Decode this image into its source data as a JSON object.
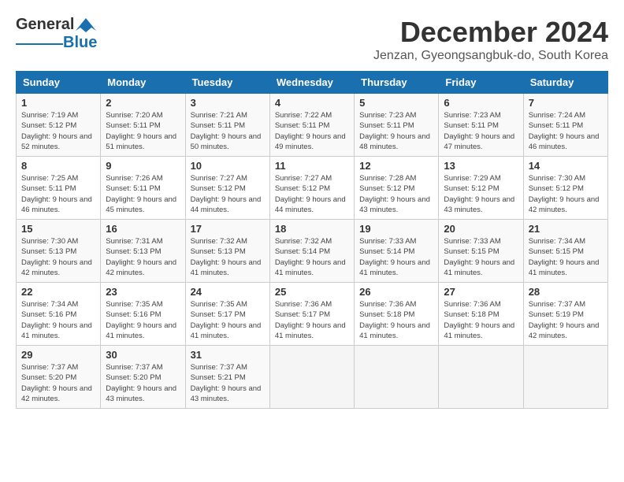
{
  "header": {
    "logo_general": "General",
    "logo_blue": "Blue",
    "month_title": "December 2024",
    "location": "Jenzan, Gyeongsangbuk-do, South Korea"
  },
  "days_of_week": [
    "Sunday",
    "Monday",
    "Tuesday",
    "Wednesday",
    "Thursday",
    "Friday",
    "Saturday"
  ],
  "weeks": [
    [
      {
        "day": 1,
        "sunrise": "7:19 AM",
        "sunset": "5:12 PM",
        "daylight": "9 hours and 52 minutes."
      },
      {
        "day": 2,
        "sunrise": "7:20 AM",
        "sunset": "5:11 PM",
        "daylight": "9 hours and 51 minutes."
      },
      {
        "day": 3,
        "sunrise": "7:21 AM",
        "sunset": "5:11 PM",
        "daylight": "9 hours and 50 minutes."
      },
      {
        "day": 4,
        "sunrise": "7:22 AM",
        "sunset": "5:11 PM",
        "daylight": "9 hours and 49 minutes."
      },
      {
        "day": 5,
        "sunrise": "7:23 AM",
        "sunset": "5:11 PM",
        "daylight": "9 hours and 48 minutes."
      },
      {
        "day": 6,
        "sunrise": "7:23 AM",
        "sunset": "5:11 PM",
        "daylight": "9 hours and 47 minutes."
      },
      {
        "day": 7,
        "sunrise": "7:24 AM",
        "sunset": "5:11 PM",
        "daylight": "9 hours and 46 minutes."
      }
    ],
    [
      {
        "day": 8,
        "sunrise": "7:25 AM",
        "sunset": "5:11 PM",
        "daylight": "9 hours and 46 minutes."
      },
      {
        "day": 9,
        "sunrise": "7:26 AM",
        "sunset": "5:11 PM",
        "daylight": "9 hours and 45 minutes."
      },
      {
        "day": 10,
        "sunrise": "7:27 AM",
        "sunset": "5:12 PM",
        "daylight": "9 hours and 44 minutes."
      },
      {
        "day": 11,
        "sunrise": "7:27 AM",
        "sunset": "5:12 PM",
        "daylight": "9 hours and 44 minutes."
      },
      {
        "day": 12,
        "sunrise": "7:28 AM",
        "sunset": "5:12 PM",
        "daylight": "9 hours and 43 minutes."
      },
      {
        "day": 13,
        "sunrise": "7:29 AM",
        "sunset": "5:12 PM",
        "daylight": "9 hours and 43 minutes."
      },
      {
        "day": 14,
        "sunrise": "7:30 AM",
        "sunset": "5:12 PM",
        "daylight": "9 hours and 42 minutes."
      }
    ],
    [
      {
        "day": 15,
        "sunrise": "7:30 AM",
        "sunset": "5:13 PM",
        "daylight": "9 hours and 42 minutes."
      },
      {
        "day": 16,
        "sunrise": "7:31 AM",
        "sunset": "5:13 PM",
        "daylight": "9 hours and 42 minutes."
      },
      {
        "day": 17,
        "sunrise": "7:32 AM",
        "sunset": "5:13 PM",
        "daylight": "9 hours and 41 minutes."
      },
      {
        "day": 18,
        "sunrise": "7:32 AM",
        "sunset": "5:14 PM",
        "daylight": "9 hours and 41 minutes."
      },
      {
        "day": 19,
        "sunrise": "7:33 AM",
        "sunset": "5:14 PM",
        "daylight": "9 hours and 41 minutes."
      },
      {
        "day": 20,
        "sunrise": "7:33 AM",
        "sunset": "5:15 PM",
        "daylight": "9 hours and 41 minutes."
      },
      {
        "day": 21,
        "sunrise": "7:34 AM",
        "sunset": "5:15 PM",
        "daylight": "9 hours and 41 minutes."
      }
    ],
    [
      {
        "day": 22,
        "sunrise": "7:34 AM",
        "sunset": "5:16 PM",
        "daylight": "9 hours and 41 minutes."
      },
      {
        "day": 23,
        "sunrise": "7:35 AM",
        "sunset": "5:16 PM",
        "daylight": "9 hours and 41 minutes."
      },
      {
        "day": 24,
        "sunrise": "7:35 AM",
        "sunset": "5:17 PM",
        "daylight": "9 hours and 41 minutes."
      },
      {
        "day": 25,
        "sunrise": "7:36 AM",
        "sunset": "5:17 PM",
        "daylight": "9 hours and 41 minutes."
      },
      {
        "day": 26,
        "sunrise": "7:36 AM",
        "sunset": "5:18 PM",
        "daylight": "9 hours and 41 minutes."
      },
      {
        "day": 27,
        "sunrise": "7:36 AM",
        "sunset": "5:18 PM",
        "daylight": "9 hours and 41 minutes."
      },
      {
        "day": 28,
        "sunrise": "7:37 AM",
        "sunset": "5:19 PM",
        "daylight": "9 hours and 42 minutes."
      }
    ],
    [
      {
        "day": 29,
        "sunrise": "7:37 AM",
        "sunset": "5:20 PM",
        "daylight": "9 hours and 42 minutes."
      },
      {
        "day": 30,
        "sunrise": "7:37 AM",
        "sunset": "5:20 PM",
        "daylight": "9 hours and 43 minutes."
      },
      {
        "day": 31,
        "sunrise": "7:37 AM",
        "sunset": "5:21 PM",
        "daylight": "9 hours and 43 minutes."
      },
      null,
      null,
      null,
      null
    ]
  ],
  "labels": {
    "sunrise": "Sunrise:",
    "sunset": "Sunset:",
    "daylight": "Daylight:"
  }
}
